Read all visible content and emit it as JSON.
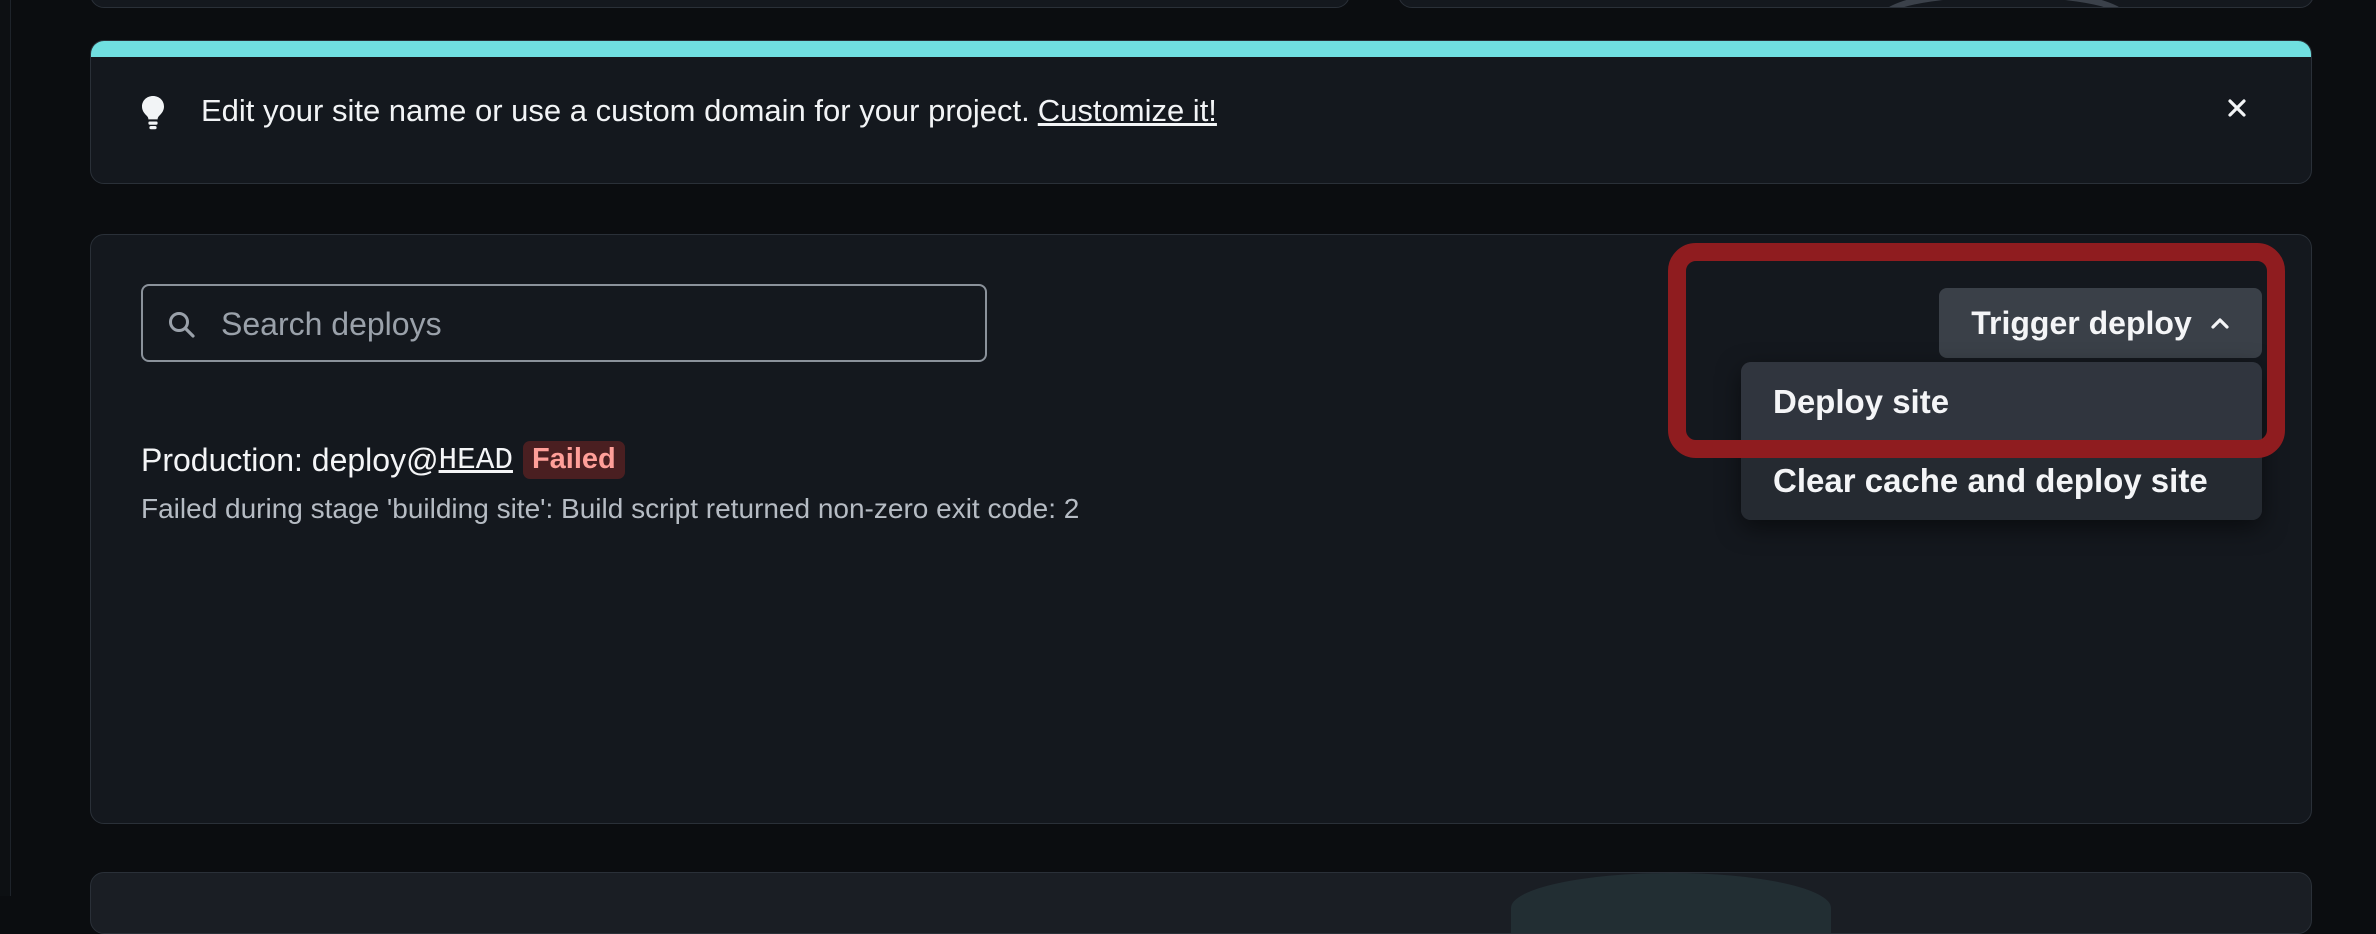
{
  "banner": {
    "message": "Edit your site name or use a custom domain for your project.",
    "link_label": "Customize it!",
    "accent_color": "#70dfe0",
    "icon": "lightbulb-icon"
  },
  "deploys": {
    "search": {
      "placeholder": "Search deploys",
      "value": ""
    },
    "trigger_button": {
      "label": "Trigger deploy",
      "icon": "chevron-up-icon"
    },
    "menu": {
      "items": [
        {
          "label": "Deploy site"
        },
        {
          "label": "Clear cache and deploy site"
        }
      ]
    },
    "list": [
      {
        "title_prefix": "Production: deploy@",
        "ref": "HEAD",
        "status": "Failed",
        "status_color": "#ff9f99",
        "error": "Failed during stage 'building site': Build script returned non-zero exit code: 2"
      }
    ]
  },
  "highlight_color": "#8f1c1f"
}
